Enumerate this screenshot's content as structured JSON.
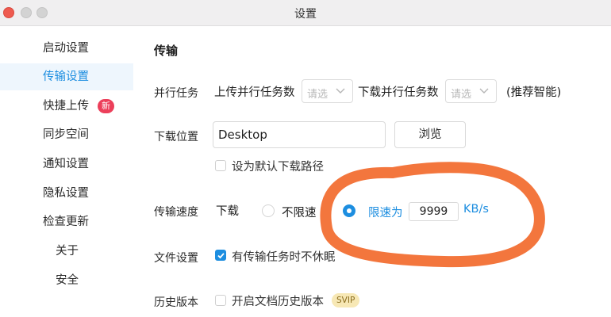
{
  "window": {
    "title": "设置"
  },
  "sidebar": {
    "items": [
      {
        "label": "启动设置"
      },
      {
        "label": "传输设置",
        "active": true
      },
      {
        "label": "快捷上传",
        "badge": "新"
      },
      {
        "label": "同步空间"
      },
      {
        "label": "通知设置"
      },
      {
        "label": "隐私设置"
      },
      {
        "label": "检查更新"
      },
      {
        "label": "关于"
      },
      {
        "label": "安全"
      }
    ]
  },
  "main": {
    "section_title": "传输",
    "parallel": {
      "label": "并行任务",
      "upload_label": "上传并行任务数",
      "upload_placeholder": "请选",
      "download_label": "下载并行任务数",
      "download_placeholder": "请选",
      "hint": "(推荐智能)"
    },
    "download_location": {
      "label": "下载位置",
      "value": "Desktop",
      "browse_label": "浏览",
      "default_path_label": "设为默认下载路径",
      "default_path_checked": false
    },
    "speed": {
      "label": "传输速度",
      "download_label": "下载",
      "unlimited_label": "不限速",
      "limit_label": "限速为",
      "limit_value": "9999",
      "unit": "KB/s",
      "selected": "limit"
    },
    "file_settings": {
      "label": "文件设置",
      "no_sleep_label": "有传输任务时不休眠",
      "no_sleep_checked": true
    },
    "history": {
      "label": "历史版本",
      "enable_label": "开启文档历史版本",
      "enable_checked": false,
      "badge": "SVIP"
    }
  },
  "colors": {
    "accent": "#1d8ee0",
    "new_badge": "#ec3f5a",
    "annotation": "#f26a2c",
    "svip_bg": "#f7e8b5"
  }
}
